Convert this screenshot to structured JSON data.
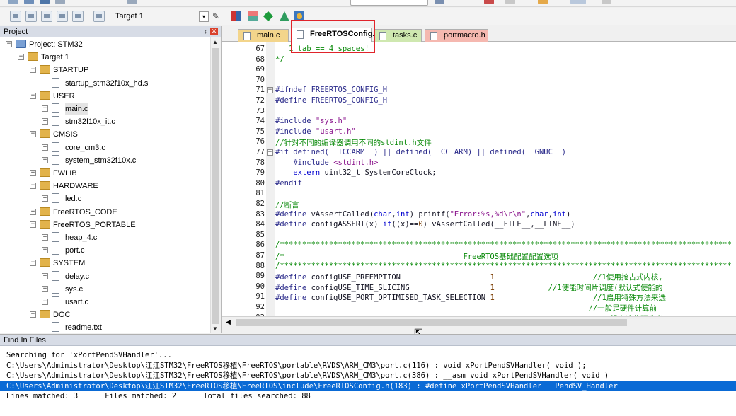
{
  "toolbar": {
    "target_label": "Target 1",
    "dropdown_arrow": "▾"
  },
  "project_panel": {
    "title": "Project",
    "pin_glyph": "ᵖ",
    "close_glyph": "✕",
    "tree": [
      {
        "label": "Project: STM32",
        "icon": "project-icon",
        "level": 0,
        "expander": "−"
      },
      {
        "label": "Target 1",
        "icon": "target-icon",
        "level": 1,
        "expander": "−"
      },
      {
        "label": "STARTUP",
        "icon": "folder-icon",
        "level": 2,
        "expander": "−"
      },
      {
        "label": "startup_stm32f10x_hd.s",
        "icon": "file-icon",
        "level": 3,
        "expander": ""
      },
      {
        "label": "USER",
        "icon": "folder-icon",
        "level": 2,
        "expander": "−"
      },
      {
        "label": "main.c",
        "icon": "file-icon",
        "level": 3,
        "expander": "+",
        "selected": true
      },
      {
        "label": "stm32f10x_it.c",
        "icon": "file-icon",
        "level": 3,
        "expander": "+"
      },
      {
        "label": "CMSIS",
        "icon": "folder-icon",
        "level": 2,
        "expander": "−"
      },
      {
        "label": "core_cm3.c",
        "icon": "file-icon",
        "level": 3,
        "expander": "+"
      },
      {
        "label": "system_stm32f10x.c",
        "icon": "file-icon",
        "level": 3,
        "expander": "+"
      },
      {
        "label": "FWLIB",
        "icon": "folder-icon",
        "level": 2,
        "expander": "+"
      },
      {
        "label": "HARDWARE",
        "icon": "folder-icon",
        "level": 2,
        "expander": "−"
      },
      {
        "label": "led.c",
        "icon": "file-icon",
        "level": 3,
        "expander": "+"
      },
      {
        "label": "FreeRTOS_CODE",
        "icon": "folder-icon",
        "level": 2,
        "expander": "+"
      },
      {
        "label": "FreeRTOS_PORTABLE",
        "icon": "folder-icon",
        "level": 2,
        "expander": "−"
      },
      {
        "label": "heap_4.c",
        "icon": "file-icon",
        "level": 3,
        "expander": "+"
      },
      {
        "label": "port.c",
        "icon": "file-icon",
        "level": 3,
        "expander": "+"
      },
      {
        "label": "SYSTEM",
        "icon": "folder-icon",
        "level": 2,
        "expander": "−"
      },
      {
        "label": "delay.c",
        "icon": "file-icon",
        "level": 3,
        "expander": "+"
      },
      {
        "label": "sys.c",
        "icon": "file-icon",
        "level": 3,
        "expander": "+"
      },
      {
        "label": "usart.c",
        "icon": "file-icon",
        "level": 3,
        "expander": "+"
      },
      {
        "label": "DOC",
        "icon": "folder-icon",
        "level": 2,
        "expander": "−"
      },
      {
        "label": "readme.txt",
        "icon": "file-icon",
        "level": 3,
        "expander": ""
      }
    ]
  },
  "editor": {
    "tabs": [
      {
        "label": "main.c",
        "color": "#f3d58b",
        "active": false
      },
      {
        "label": "FreeRTOSConfig.h",
        "color": "#ffffff",
        "active": true
      },
      {
        "label": "tasks.c",
        "color": "#cfe8b0",
        "active": false
      },
      {
        "label": "portmacro.h",
        "color": "#f5b8b0",
        "active": false
      }
    ],
    "highlight_color": "#e0242b",
    "lines": [
      {
        "n": "67",
        "fold": "",
        "seg": [
          {
            "c": "cm",
            "t": "   1 tab == 4 spaces!"
          }
        ]
      },
      {
        "n": "68",
        "fold": "",
        "seg": [
          {
            "c": "cm",
            "t": "*/"
          }
        ]
      },
      {
        "n": "69",
        "fold": "",
        "seg": []
      },
      {
        "n": "70",
        "fold": "",
        "seg": []
      },
      {
        "n": "71",
        "fold": "−",
        "seg": [
          {
            "c": "pp",
            "t": "#ifndef FREERTOS_CONFIG_H"
          }
        ]
      },
      {
        "n": "72",
        "fold": "",
        "seg": [
          {
            "c": "pp",
            "t": "#define FREERTOS_CONFIG_H"
          }
        ]
      },
      {
        "n": "73",
        "fold": "",
        "seg": []
      },
      {
        "n": "74",
        "fold": "",
        "seg": [
          {
            "c": "pp",
            "t": "#include "
          },
          {
            "c": "st",
            "t": "\"sys.h\""
          }
        ]
      },
      {
        "n": "75",
        "fold": "",
        "seg": [
          {
            "c": "pp",
            "t": "#include "
          },
          {
            "c": "st",
            "t": "\"usart.h\""
          }
        ]
      },
      {
        "n": "76",
        "fold": "",
        "seg": [
          {
            "c": "cm",
            "t": "//针对不同的编译器调用不同的stdint.h文件"
          }
        ]
      },
      {
        "n": "77",
        "fold": "−",
        "seg": [
          {
            "c": "pp",
            "t": "#if defined(__ICCARM__) || defined(__CC_ARM) || defined(__GNUC__)"
          }
        ]
      },
      {
        "n": "78",
        "fold": "",
        "seg": [
          {
            "c": "pp",
            "t": "    #include "
          },
          {
            "c": "st",
            "t": "<stdint.h>"
          }
        ]
      },
      {
        "n": "79",
        "fold": "",
        "seg": [
          {
            "c": "kw",
            "t": "    extern "
          },
          {
            "c": "pl",
            "t": "uint32_t SystemCoreClock;"
          }
        ]
      },
      {
        "n": "80",
        "fold": "",
        "seg": [
          {
            "c": "pp",
            "t": "#endif"
          }
        ]
      },
      {
        "n": "81",
        "fold": "",
        "seg": []
      },
      {
        "n": "82",
        "fold": "",
        "seg": [
          {
            "c": "cm",
            "t": "//断言"
          }
        ]
      },
      {
        "n": "83",
        "fold": "",
        "seg": [
          {
            "c": "pp",
            "t": "#define "
          },
          {
            "c": "pl",
            "t": "vAssertCalled("
          },
          {
            "c": "kw",
            "t": "char"
          },
          {
            "c": "pl",
            "t": ","
          },
          {
            "c": "kw",
            "t": "int"
          },
          {
            "c": "pl",
            "t": ") printf("
          },
          {
            "c": "st",
            "t": "\"Error:%s,%d\\r\\n\""
          },
          {
            "c": "pl",
            "t": ","
          },
          {
            "c": "kw",
            "t": "char"
          },
          {
            "c": "pl",
            "t": ","
          },
          {
            "c": "kw",
            "t": "int"
          },
          {
            "c": "pl",
            "t": ")"
          }
        ]
      },
      {
        "n": "84",
        "fold": "",
        "seg": [
          {
            "c": "pp",
            "t": "#define "
          },
          {
            "c": "pl",
            "t": "configASSERT(x) "
          },
          {
            "c": "kw",
            "t": "if"
          },
          {
            "c": "pl",
            "t": "((x)=="
          },
          {
            "c": "nm",
            "t": "0"
          },
          {
            "c": "pl",
            "t": ") vAssertCalled(__FILE__,__LINE__)"
          }
        ]
      },
      {
        "n": "85",
        "fold": "",
        "seg": []
      },
      {
        "n": "86",
        "fold": "",
        "seg": [
          {
            "c": "cm",
            "t": "/*****************************************************************************************************"
          }
        ]
      },
      {
        "n": "87",
        "fold": "",
        "seg": [
          {
            "c": "cm",
            "t": "/*                                        FreeRTOS基础配置配置选项"
          }
        ]
      },
      {
        "n": "88",
        "fold": "",
        "seg": [
          {
            "c": "cm",
            "t": "/*****************************************************************************************************"
          }
        ]
      },
      {
        "n": "89",
        "fold": "",
        "seg": [
          {
            "c": "pp",
            "t": "#define "
          },
          {
            "c": "pl",
            "t": "configUSE_PREEMPTION                    "
          },
          {
            "c": "nm",
            "t": "1"
          },
          {
            "c": "cm",
            "t": "                      //1使用抢占式内核,"
          }
        ]
      },
      {
        "n": "90",
        "fold": "",
        "seg": [
          {
            "c": "pp",
            "t": "#define "
          },
          {
            "c": "pl",
            "t": "configUSE_TIME_SLICING                  "
          },
          {
            "c": "nm",
            "t": "1"
          },
          {
            "c": "cm",
            "t": "            //1使能时间片调度(默认式使能的"
          }
        ]
      },
      {
        "n": "91",
        "fold": "",
        "seg": [
          {
            "c": "pp",
            "t": "#define "
          },
          {
            "c": "pl",
            "t": "configUSE_PORT_OPTIMISED_TASK_SELECTION "
          },
          {
            "c": "nm",
            "t": "1"
          },
          {
            "c": "cm",
            "t": "                      //1启用特殊方法来选"
          }
        ]
      },
      {
        "n": "92",
        "fold": "",
        "seg": [
          {
            "c": "cm",
            "t": "                                                                      //一般是硬件计算前"
          }
        ]
      },
      {
        "n": "93",
        "fold": "",
        "seg": [
          {
            "c": "cm",
            "t": "                                                                      //MCU没有这些硬件指"
          }
        ]
      }
    ]
  },
  "find_in_files": {
    "title": "Find In Files",
    "rows": [
      {
        "text": "Searching for 'xPortPendSVHandler'...",
        "highlight": false
      },
      {
        "text": "C:\\Users\\Administrator\\Desktop\\江江STM32\\FreeRTOS移植\\FreeRTOS\\portable\\RVDS\\ARM_CM3\\port.c(116) : void xPortPendSVHandler( void );",
        "highlight": false
      },
      {
        "text": "C:\\Users\\Administrator\\Desktop\\江江STM32\\FreeRTOS移植\\FreeRTOS\\portable\\RVDS\\ARM_CM3\\port.c(386) : __asm void xPortPendSVHandler( void )",
        "highlight": false
      },
      {
        "text": "C:\\Users\\Administrator\\Desktop\\江江STM32\\FreeRTOS移植\\FreeRTOS\\include\\FreeRTOSConfig.h(183) : #define xPortPendSVHandler   PendSV_Handler",
        "highlight": true
      },
      {
        "text": "Lines matched: 3      Files matched: 2      Total files searched: 88",
        "highlight": false
      }
    ]
  },
  "scroll": {
    "up": "▲",
    "down": "▼",
    "left": "◀"
  },
  "cursor_glyph": "⇱"
}
